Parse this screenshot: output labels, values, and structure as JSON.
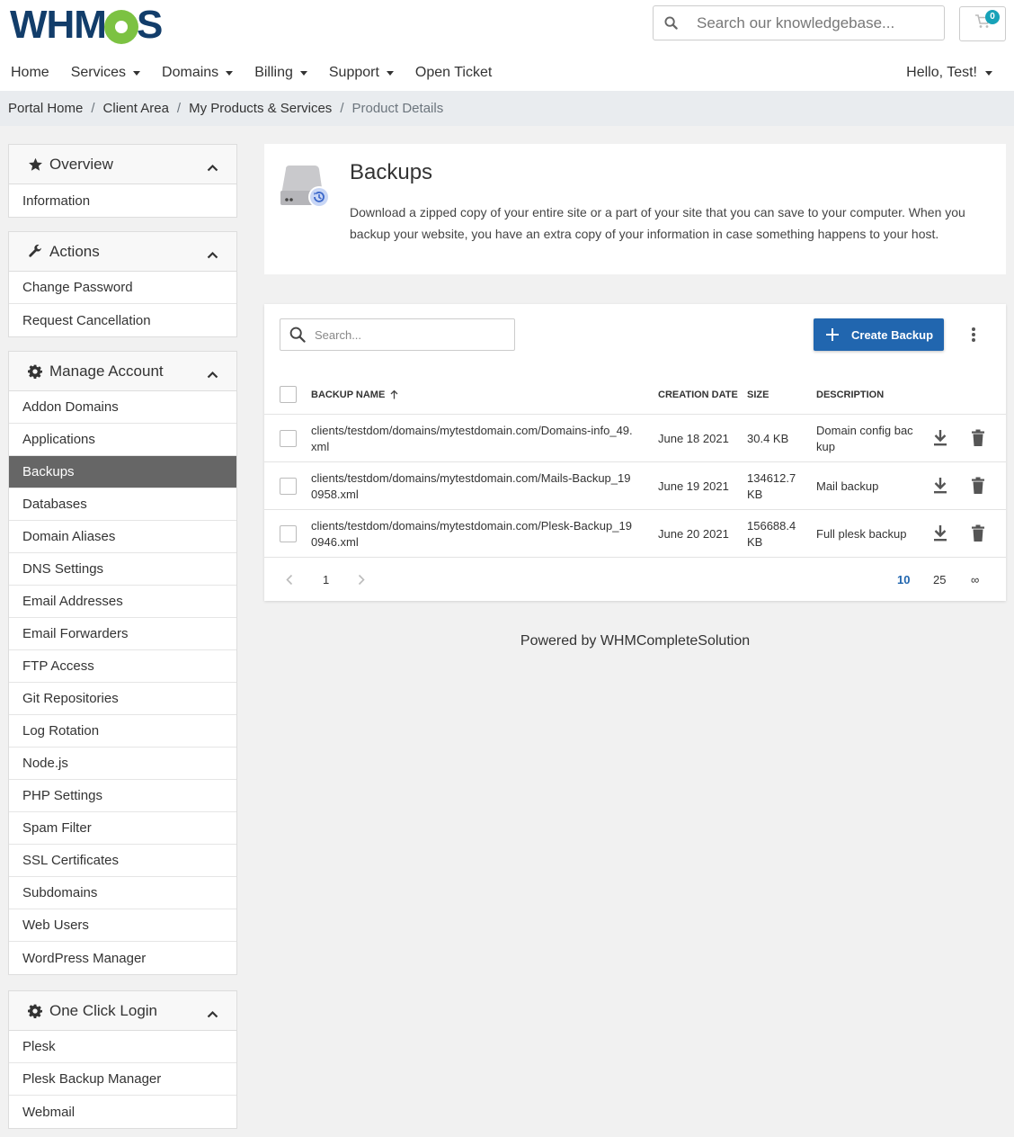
{
  "header": {
    "logo": "WHMCS",
    "search_placeholder": "Search our knowledgebase...",
    "cart_count": "0"
  },
  "nav": {
    "items": [
      "Home",
      "Services",
      "Domains",
      "Billing",
      "Support",
      "Open Ticket"
    ],
    "user": "Hello, Test!"
  },
  "breadcrumb": [
    "Portal Home",
    "Client Area",
    "My Products & Services",
    "Product Details"
  ],
  "sidebar": {
    "overview": {
      "title": "Overview",
      "items": [
        "Information"
      ]
    },
    "actions": {
      "title": "Actions",
      "items": [
        "Change Password",
        "Request Cancellation"
      ]
    },
    "manage": {
      "title": "Manage Account",
      "items": [
        "Addon Domains",
        "Applications",
        "Backups",
        "Databases",
        "Domain Aliases",
        "DNS Settings",
        "Email Addresses",
        "Email Forwarders",
        "FTP Access",
        "Git Repositories",
        "Log Rotation",
        "Node.js",
        "PHP Settings",
        "Spam Filter",
        "SSL Certificates",
        "Subdomains",
        "Web Users",
        "WordPress Manager"
      ],
      "active": "Backups"
    },
    "oneclick": {
      "title": "One Click Login",
      "items": [
        "Plesk",
        "Plesk Backup Manager",
        "Webmail"
      ]
    }
  },
  "intro": {
    "title": "Backups",
    "description": "Download a zipped copy of your entire site or a part of your site that you can save to your computer. When you backup your website, you have an extra copy of your information in case something happens to your host."
  },
  "table": {
    "search_placeholder": "Search...",
    "create_label": "Create Backup",
    "columns": {
      "name": "BACKUP NAME",
      "date": "CREATION DATE",
      "size": "SIZE",
      "description": "DESCRIPTION"
    },
    "rows": [
      {
        "name": "clients/testdom/domains/mytestdomain.com/Domains-info_49.xml",
        "date": "June 18 2021",
        "size": "30.4 KB",
        "description": "Domain config backup"
      },
      {
        "name": "clients/testdom/domains/mytestdomain.com/Mails-Backup_190958.xml",
        "date": "June 19 2021",
        "size": "134612.7 KB",
        "description": "Mail backup"
      },
      {
        "name": "clients/testdom/domains/mytestdomain.com/Plesk-Backup_190946.xml",
        "date": "June 20 2021",
        "size": "156688.4 KB",
        "description": "Full plesk backup"
      }
    ],
    "pagination": {
      "current": "1",
      "page_sizes": [
        "10",
        "25",
        "∞"
      ],
      "selected_size": "10"
    }
  },
  "footer": {
    "text": "Powered by WHMCompleteSolution"
  },
  "colors": {
    "brand": "#123d6a",
    "accent": "#2166af",
    "logo_green": "#7cc242",
    "active_item": "#666666"
  }
}
